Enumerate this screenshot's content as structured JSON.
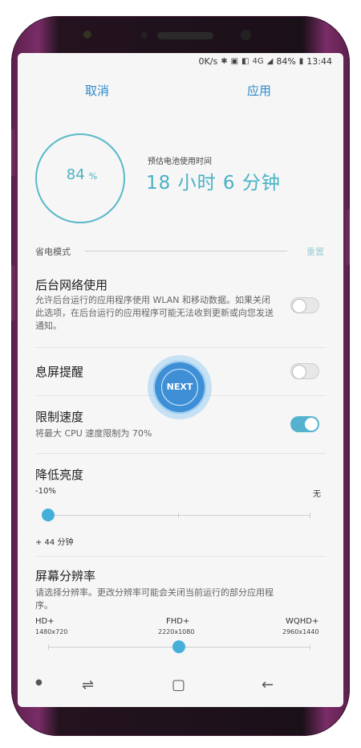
{
  "status_bar": {
    "speed": "0K/s",
    "signal": "4G",
    "battery": "84%",
    "time": "13:44"
  },
  "action_bar": {
    "cancel": "取消",
    "apply": "应用"
  },
  "battery": {
    "percent_value": "84",
    "percent_unit": "%",
    "estimate_label": "预估电池使用时间",
    "estimate_time": "18 小时 6 分钟",
    "level_fraction": 0.84
  },
  "section": {
    "label": "省电模式",
    "reset": "重置"
  },
  "settings": {
    "background_network": {
      "title": "后台网络使用",
      "description": "允许后台运行的应用程序使用 WLAN 和移动数据。如果关闭此选项，在后台运行的应用程序可能无法收到更新或向您发送通知。",
      "enabled": false
    },
    "screen_off_reminder": {
      "title": "息屏提醒",
      "enabled": false
    },
    "limit_speed": {
      "title": "限制速度",
      "description": "将最大 CPU 速度限制为 70%",
      "enabled": true
    },
    "reduce_brightness": {
      "title": "降低亮度",
      "min_label": "-10%",
      "max_label": "无",
      "note": "+ 44 分钟",
      "value_fraction": 0.0
    },
    "screen_resolution": {
      "title": "屏幕分辨率",
      "description": "请选择分辨率。更改分辨率可能会关闭当前运行的部分应用程序。",
      "options": [
        {
          "name": "HD+",
          "size": "1480x720"
        },
        {
          "name": "FHD+",
          "size": "2220x1080"
        },
        {
          "name": "WQHD+",
          "size": "2960x1440"
        }
      ],
      "selected_index": 1
    }
  },
  "overlay": {
    "next_label": "NEXT"
  },
  "colors": {
    "accent": "#2b8ac9",
    "teal": "#49b1c6",
    "toggle_on": "#55b2cf",
    "phone_frame": "#7a2d68"
  }
}
